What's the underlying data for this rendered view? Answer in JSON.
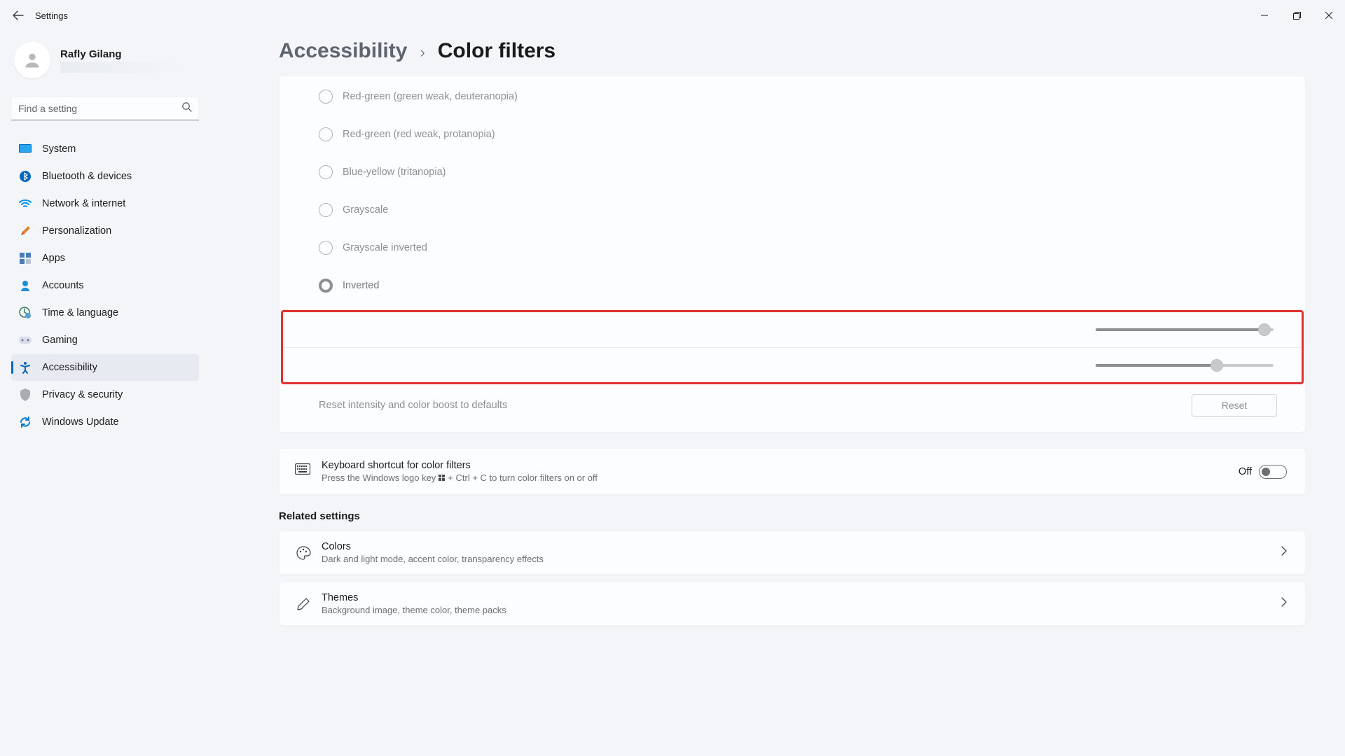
{
  "window": {
    "title": "Settings"
  },
  "profile": {
    "name": "Rafly Gilang"
  },
  "search": {
    "placeholder": "Find a setting"
  },
  "sidebar": {
    "items": [
      {
        "label": "System"
      },
      {
        "label": "Bluetooth & devices"
      },
      {
        "label": "Network & internet"
      },
      {
        "label": "Personalization"
      },
      {
        "label": "Apps"
      },
      {
        "label": "Accounts"
      },
      {
        "label": "Time & language"
      },
      {
        "label": "Gaming"
      },
      {
        "label": "Accessibility"
      },
      {
        "label": "Privacy & security"
      },
      {
        "label": "Windows Update"
      }
    ],
    "active_index": 8
  },
  "breadcrumb": {
    "parent": "Accessibility",
    "sep": "›",
    "current": "Color filters"
  },
  "filters": {
    "options": [
      {
        "label": "Red-green (green weak, deuteranopia)"
      },
      {
        "label": "Red-green (red weak, protanopia)"
      },
      {
        "label": "Blue-yellow (tritanopia)"
      },
      {
        "label": "Grayscale"
      },
      {
        "label": "Grayscale inverted"
      },
      {
        "label": "Inverted"
      }
    ],
    "selected_index": 5
  },
  "sliders": {
    "intensity_pct": 95,
    "color_boost_pct": 68
  },
  "reset": {
    "label": "Reset intensity and color boost to defaults",
    "button": "Reset"
  },
  "shortcut": {
    "title": "Keyboard shortcut for color filters",
    "sub_prefix": "Press the Windows logo key",
    "sub_suffix": "+ Ctrl + C to turn color filters on or off",
    "toggle_label": "Off"
  },
  "related": {
    "title": "Related settings",
    "links": [
      {
        "title": "Colors",
        "sub": "Dark and light mode, accent color, transparency effects"
      },
      {
        "title": "Themes",
        "sub": "Background image, theme color, theme packs"
      }
    ]
  }
}
